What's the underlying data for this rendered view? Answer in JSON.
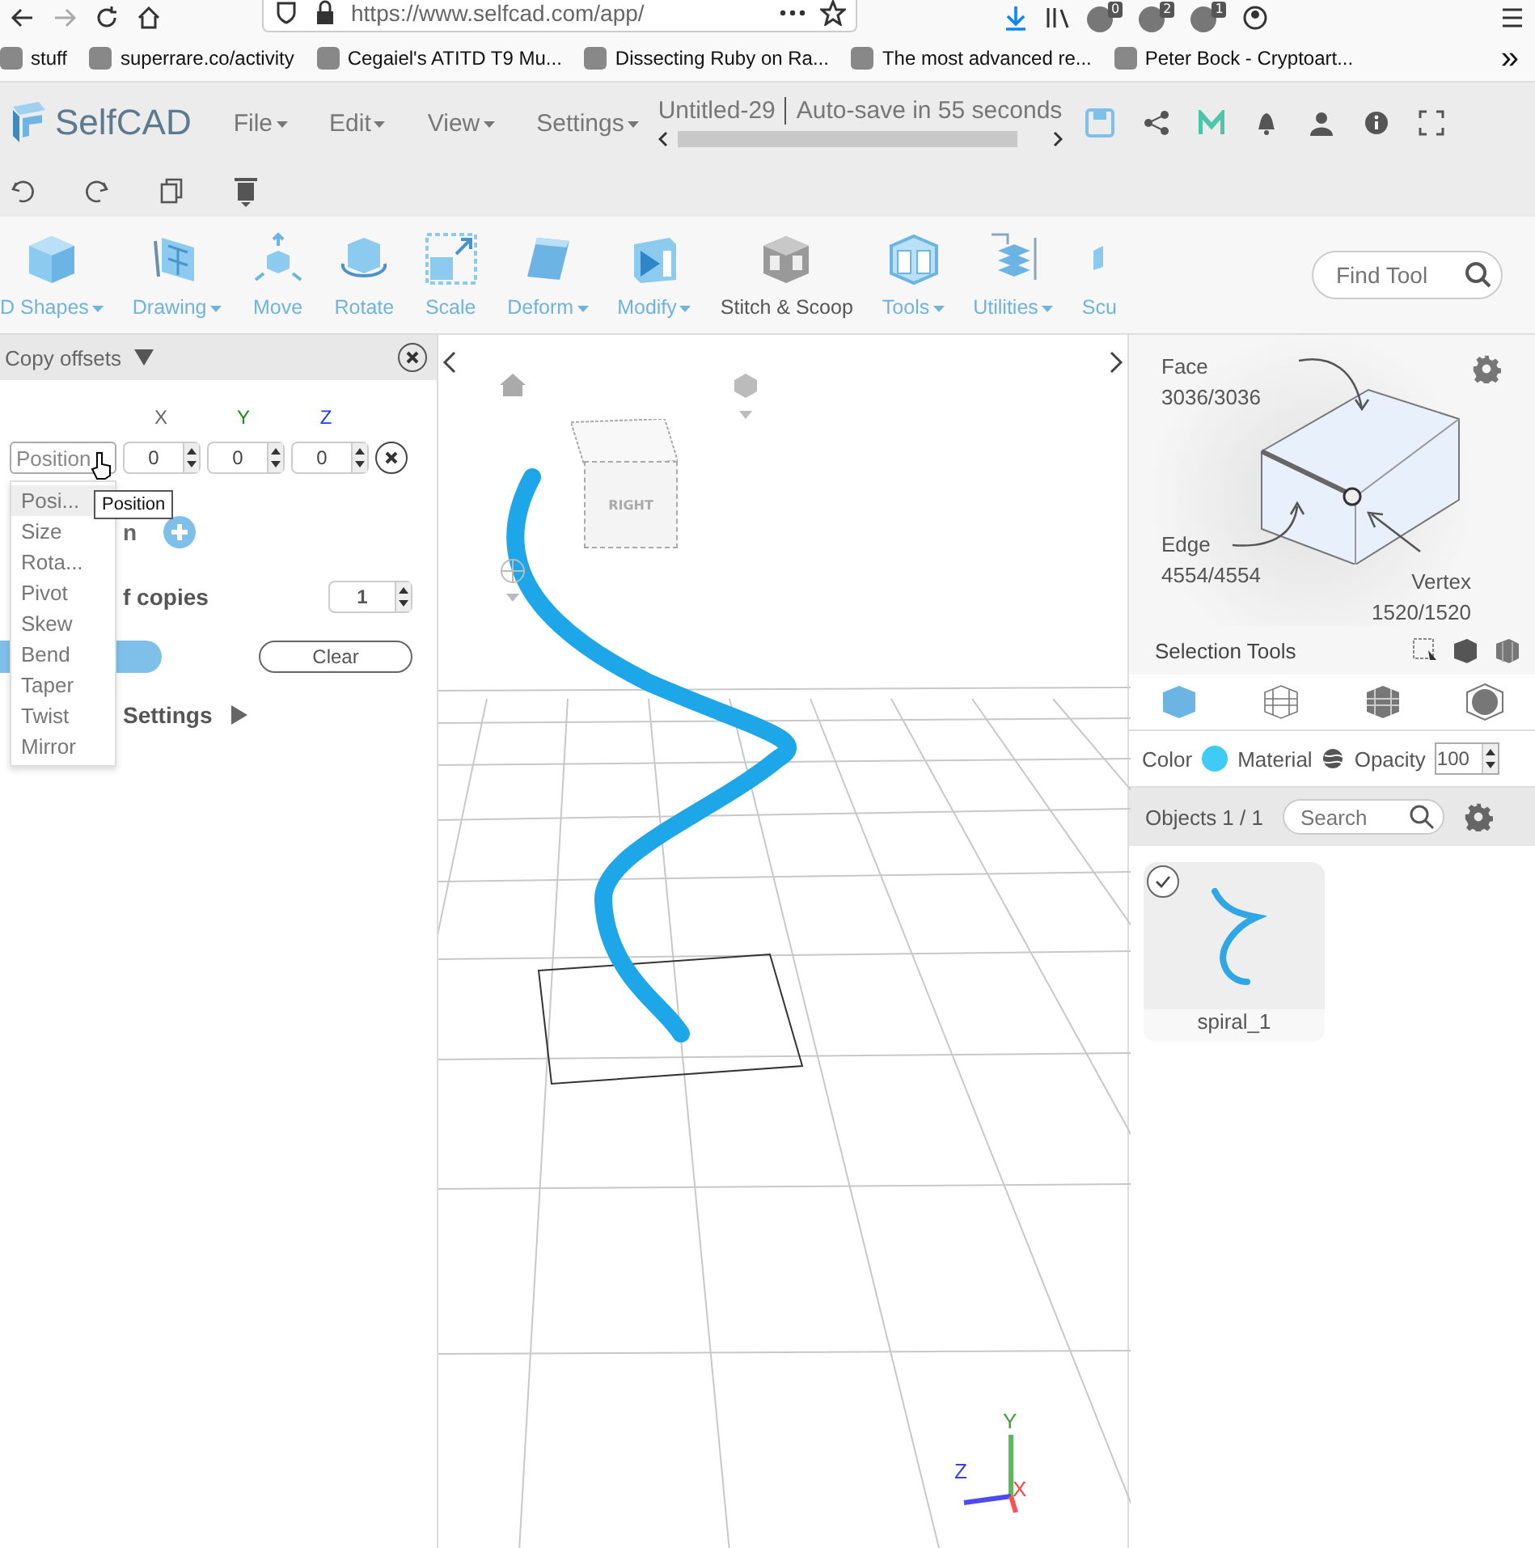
{
  "browser": {
    "url": "https://www.selfcad.com/app/",
    "extension_badges": [
      "0",
      "2",
      "1"
    ],
    "bookmarks": [
      {
        "label": "stuff"
      },
      {
        "label": "superrare.co/activity"
      },
      {
        "label": "Cegaiel's ATITD T9 Mu..."
      },
      {
        "label": "Dissecting Ruby on Ra..."
      },
      {
        "label": "The most advanced re..."
      },
      {
        "label": "Peter Bock - Cryptoart..."
      }
    ],
    "overflow": "»"
  },
  "app": {
    "logo": "SelfCAD",
    "menus": [
      "File",
      "Edit",
      "View",
      "Settings"
    ],
    "title": "Untitled-29",
    "autosave": "Auto-save in 55 seconds"
  },
  "tools": [
    {
      "label": "D Shapes",
      "dropdown": true,
      "disabled": false
    },
    {
      "label": "Drawing",
      "dropdown": true,
      "disabled": false
    },
    {
      "label": "Move",
      "dropdown": false,
      "disabled": false
    },
    {
      "label": "Rotate",
      "dropdown": false,
      "disabled": false
    },
    {
      "label": "Scale",
      "dropdown": false,
      "disabled": false
    },
    {
      "label": "Deform",
      "dropdown": true,
      "disabled": false
    },
    {
      "label": "Modify",
      "dropdown": true,
      "disabled": false
    },
    {
      "label": "Stitch & Scoop",
      "dropdown": false,
      "disabled": true
    },
    {
      "label": "Tools",
      "dropdown": true,
      "disabled": false
    },
    {
      "label": "Utilities",
      "dropdown": true,
      "disabled": false
    },
    {
      "label": "Scu",
      "dropdown": false,
      "disabled": false
    }
  ],
  "find_tool": {
    "placeholder": "Find Tool"
  },
  "copy_panel": {
    "title": "Copy offsets",
    "axes": [
      {
        "label": "X",
        "color": "#666666"
      },
      {
        "label": "Y",
        "color": "#1e8c1e"
      },
      {
        "label": "Z",
        "color": "#1f3cf0"
      }
    ],
    "transform": "Position",
    "offsets": [
      "0",
      "0",
      "0"
    ],
    "dropdown": [
      {
        "label": "Posi...",
        "selected": true
      },
      {
        "label": "Size",
        "selected": false
      },
      {
        "label": "Rota...",
        "selected": false
      },
      {
        "label": "Pivot",
        "selected": false
      },
      {
        "label": "Skew",
        "selected": false
      },
      {
        "label": "Bend",
        "selected": false
      },
      {
        "label": "Taper",
        "selected": false
      },
      {
        "label": "Twist",
        "selected": false
      },
      {
        "label": "Mirror",
        "selected": false
      }
    ],
    "tooltip": "Position",
    "partial_label": "n",
    "copies_label": "f copies",
    "copies": "1",
    "clear": "Clear",
    "settings": "Settings"
  },
  "viewport": {
    "cube_face": "RIGHT",
    "axes": [
      {
        "label": "Y",
        "color": "#3aa03a"
      },
      {
        "label": "Z",
        "color": "#4040e0"
      },
      {
        "label": "X",
        "color": "#ff4040"
      }
    ]
  },
  "selection": {
    "face_label": "Face",
    "face_count": "3036/3036",
    "edge_label": "Edge",
    "edge_count": "4554/4554",
    "vertex_label": "Vertex",
    "vertex_count": "1520/1520",
    "tools_label": "Selection Tools",
    "modes": [
      {
        "kind": "solid",
        "selected": true
      },
      {
        "kind": "wireframe",
        "selected": false
      },
      {
        "kind": "grid",
        "selected": false
      },
      {
        "kind": "xray",
        "selected": false
      }
    ]
  },
  "properties": {
    "color_label": "Color",
    "color": "#3ecbf5",
    "material_label": "Material",
    "opacity_label": "Opacity",
    "opacity": "100"
  },
  "objects": {
    "title": "Objects 1 / 1",
    "search_placeholder": "Search",
    "items": [
      {
        "name": "spiral_1",
        "checked": true
      }
    ]
  }
}
